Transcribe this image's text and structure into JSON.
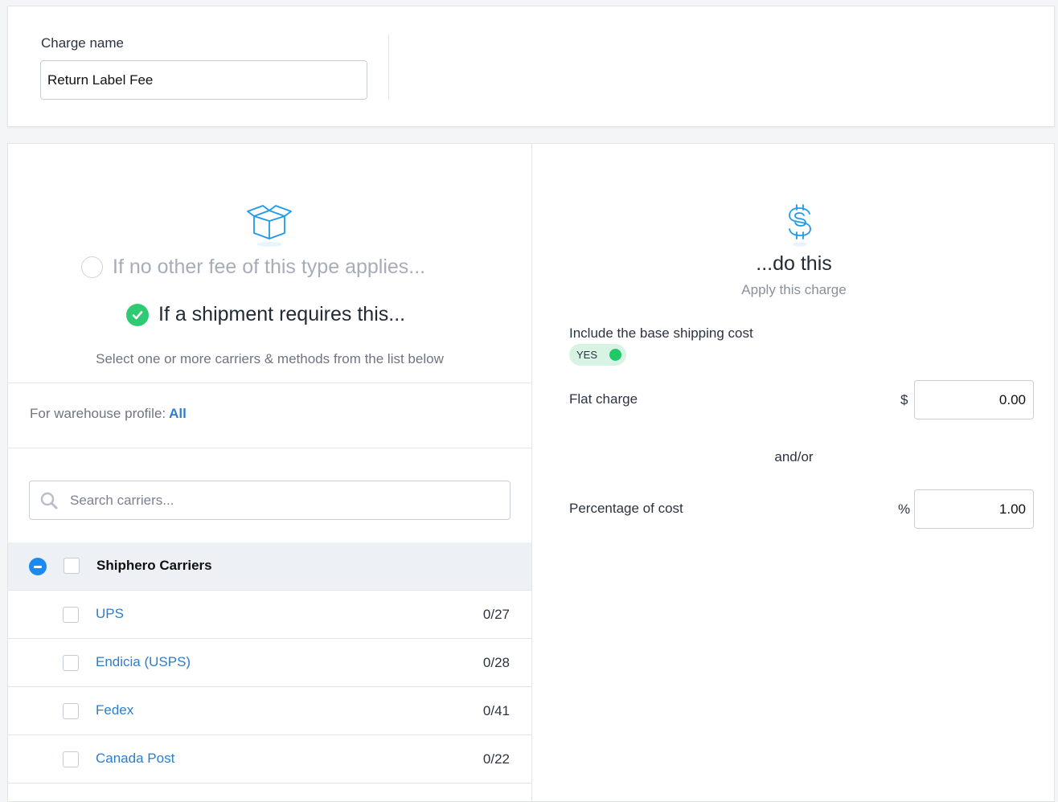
{
  "header": {
    "charge_name_label": "Charge name",
    "charge_name_value": "Return Label Fee"
  },
  "conditions": {
    "option_no_other_fee": "If no other fee of this type applies...",
    "option_shipment_requires": "If a shipment requires this...",
    "select_hint": "Select one or more carriers & methods from the list below",
    "warehouse_label": "For warehouse profile:",
    "warehouse_value": "All",
    "search_placeholder": "Search carriers...",
    "group_label": "Shiphero Carriers",
    "carriers": [
      {
        "name": "UPS",
        "count": "0/27"
      },
      {
        "name": "Endicia (USPS)",
        "count": "0/28"
      },
      {
        "name": "Fedex",
        "count": "0/41"
      },
      {
        "name": "Canada Post",
        "count": "0/22"
      }
    ]
  },
  "action": {
    "title": "...do this",
    "subtitle": "Apply this charge",
    "base_cost_label": "Include the base shipping cost",
    "base_cost_toggle": "YES",
    "flat_charge_label": "Flat charge",
    "flat_charge_unit": "$",
    "flat_charge_value": "0.00",
    "and_or": "and/or",
    "percentage_label": "Percentage of cost",
    "percentage_unit": "%",
    "percentage_value": "1.00"
  },
  "colors": {
    "accent_blue": "#2a7fd4",
    "check_green": "#2fcb72",
    "toggle_bg": "#d8f3e3",
    "toggle_knob": "#20c866",
    "icon_blue": "#1e9be8"
  },
  "icons": {
    "box": "open-box-icon",
    "dollar": "dollar-sign-icon",
    "search": "search-icon",
    "check": "checkmark-icon",
    "collapse": "minus-circle-icon"
  }
}
